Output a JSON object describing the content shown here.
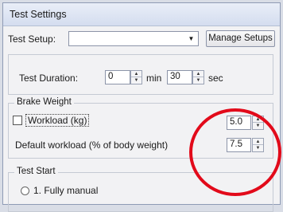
{
  "window": {
    "title": "Test Settings"
  },
  "setup": {
    "label": "Test Setup:",
    "selected": "",
    "manage_button": "Manage Setups"
  },
  "duration": {
    "label": "Test Duration:",
    "minutes": "0",
    "min_unit": "min",
    "seconds": "30",
    "sec_unit": "sec"
  },
  "brake": {
    "legend": "Brake Weight",
    "workload_label": "Workload (kg)",
    "workload_checked": false,
    "workload_value": "5.0",
    "default_label": "Default workload (% of body weight)",
    "default_value": "7.5"
  },
  "test_start": {
    "legend": "Test Start",
    "option1": "1. Fully manual"
  },
  "annotation": {
    "color": "#e20a1a"
  }
}
